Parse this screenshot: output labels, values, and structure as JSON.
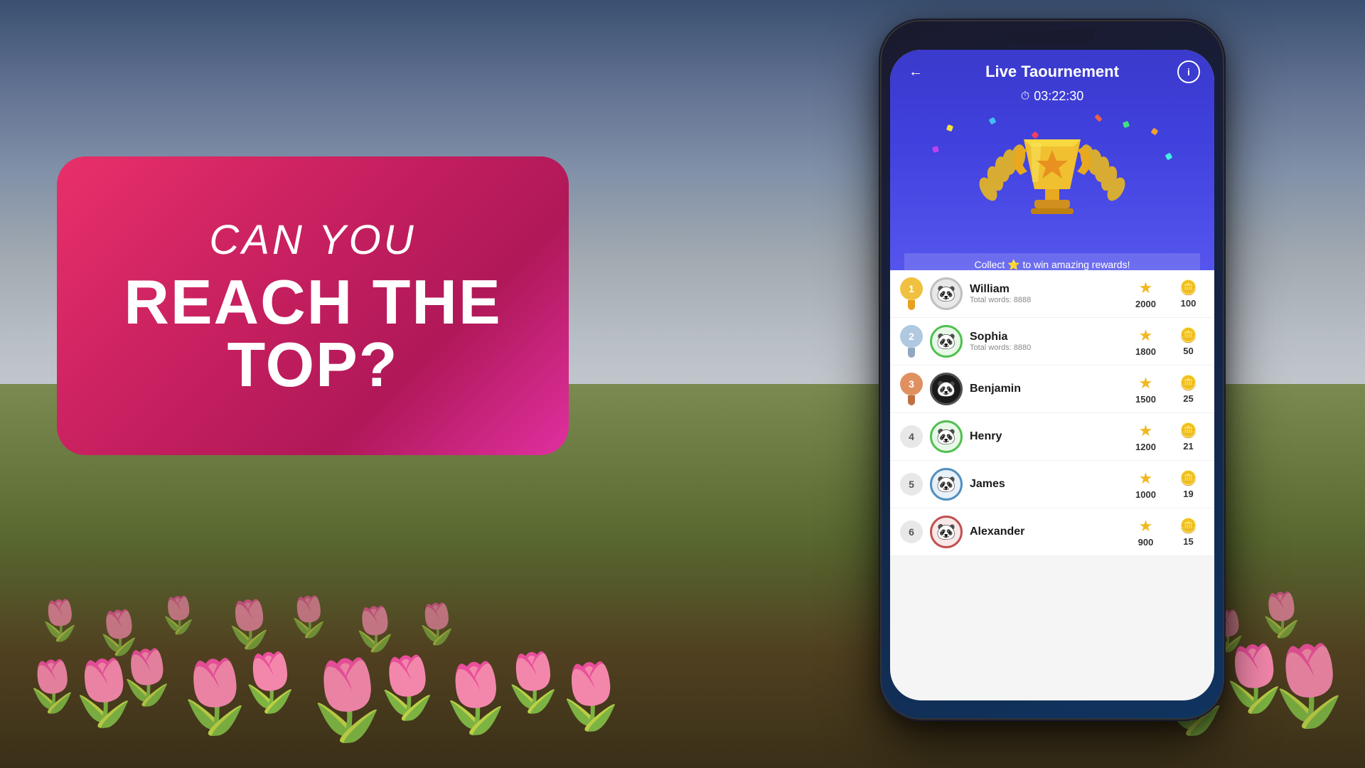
{
  "background": {
    "description": "Tulip field with mountains and cloudy sky"
  },
  "banner": {
    "line1": "CAN YOU",
    "line2": "REACH THE\nTOP?"
  },
  "phone": {
    "app": {
      "title": "Live Taournement",
      "timer": "03:22:30",
      "collect_text": "Collect ⭐ to win amazing rewards!",
      "nav": {
        "back_label": "←",
        "info_label": "i"
      },
      "leaderboard": [
        {
          "rank": 1,
          "name": "William",
          "words": "Total words: 8888",
          "score": 2000,
          "coins": 100,
          "avatar": "🐼",
          "avatar_class": "avatar-1"
        },
        {
          "rank": 2,
          "name": "Sophia",
          "words": "Total words: 8880",
          "score": 1800,
          "coins": 50,
          "avatar": "🐼",
          "avatar_class": "avatar-2"
        },
        {
          "rank": 3,
          "name": "Benjamin",
          "words": "",
          "score": 1500,
          "coins": 25,
          "avatar": "🐼",
          "avatar_class": "avatar-3"
        },
        {
          "rank": 4,
          "name": "Henry",
          "words": "",
          "score": 1200,
          "coins": 21,
          "avatar": "🐼",
          "avatar_class": "avatar-4"
        },
        {
          "rank": 5,
          "name": "James",
          "words": "",
          "score": 1000,
          "coins": 19,
          "avatar": "🐼",
          "avatar_class": "avatar-5"
        },
        {
          "rank": 6,
          "name": "Alexander",
          "words": "",
          "score": 900,
          "coins": 15,
          "avatar": "🐼",
          "avatar_class": "avatar-6"
        }
      ]
    }
  }
}
